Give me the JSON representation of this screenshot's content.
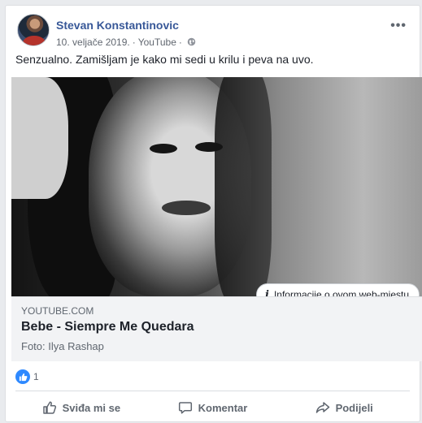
{
  "post": {
    "author": "Stevan Konstantinovic",
    "date": "10. veljače 2019.",
    "separator": "·",
    "source": "YouTube",
    "more_label": "•••",
    "text": "Senzualno. Zamišljam je kako mi sedi u krilu i peva na uvo."
  },
  "preview": {
    "info_label": "Informacije o ovom web-mjestu",
    "info_icon": "i",
    "domain": "YOUTUBE.COM",
    "title": "Bebe - Siempre Me Quedara",
    "description": "Foto: Ilya Rashap"
  },
  "reactions": {
    "count": "1",
    "icon": "like-icon",
    "color": "#2e89ff"
  },
  "actions": {
    "like": "Sviđa mi se",
    "comment": "Komentar",
    "share": "Podijeli"
  },
  "colors": {
    "link": "#385898",
    "text": "#1d2129",
    "muted": "#606770",
    "caption_bg": "#f2f3f5"
  }
}
